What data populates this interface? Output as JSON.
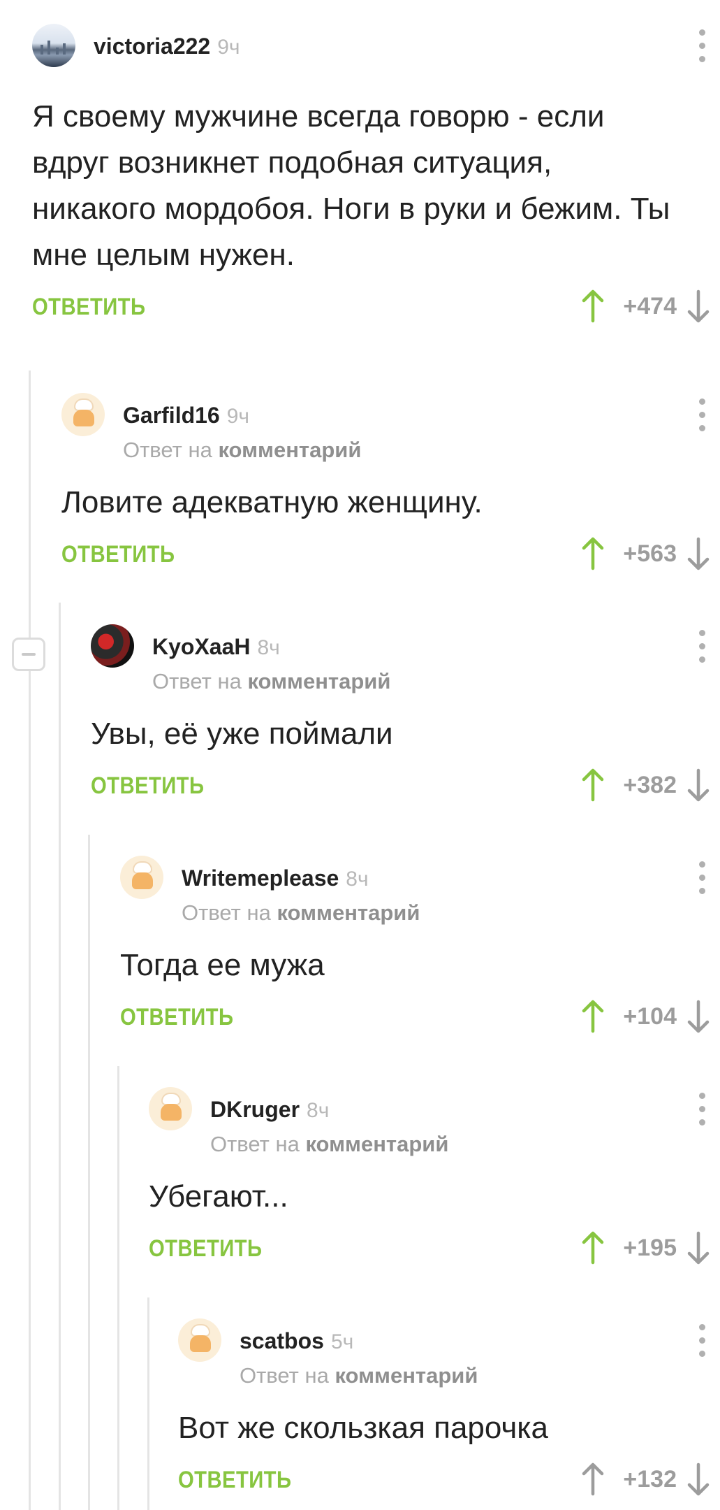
{
  "comments": [
    {
      "username": "victoria222",
      "time": "9ч",
      "body": "Я своему мужчине всегда говорю - если вдруг возникнет подобная ситуация, никакого мордобоя. Ноги в руки и бежим. Ты мне целым нужен.",
      "reply_label": "ОТВЕТИТЬ",
      "rating": "+474"
    },
    {
      "username": "Garfild16",
      "time": "9ч",
      "reply_prefix": "Ответ на",
      "reply_link": "комментарий",
      "body": "Ловите адекватную женщину.",
      "reply_label": "ОТВЕТИТЬ",
      "rating": "+563"
    },
    {
      "username": "KyoXaaH",
      "time": "8ч",
      "reply_prefix": "Ответ на",
      "reply_link": "комментарий",
      "body": "Увы, её уже поймали",
      "reply_label": "ОТВЕТИТЬ",
      "rating": "+382"
    },
    {
      "username": "Writemeplease",
      "time": "8ч",
      "reply_prefix": "Ответ на",
      "reply_link": "комментарий",
      "body": "Тогда ее мужа",
      "reply_label": "ОТВЕТИТЬ",
      "rating": "+104"
    },
    {
      "username": "DKruger",
      "time": "8ч",
      "reply_prefix": "Ответ на",
      "reply_link": "комментарий",
      "body": "Убегают...",
      "reply_label": "ОТВЕТИТЬ",
      "rating": "+195"
    },
    {
      "username": "scatbos",
      "time": "5ч",
      "reply_prefix": "Ответ на",
      "reply_link": "комментарий",
      "body": "Вот же скользкая парочка",
      "reply_label": "ОТВЕТИТЬ",
      "rating": "+132"
    }
  ],
  "colors": {
    "accent_green": "#87c540",
    "muted": "#9c9c9c",
    "thread_line": "#e4e4e4"
  },
  "icons": [
    "more-vertical-icon",
    "arrow-up-icon",
    "arrow-down-icon",
    "collapse-thread-icon"
  ]
}
